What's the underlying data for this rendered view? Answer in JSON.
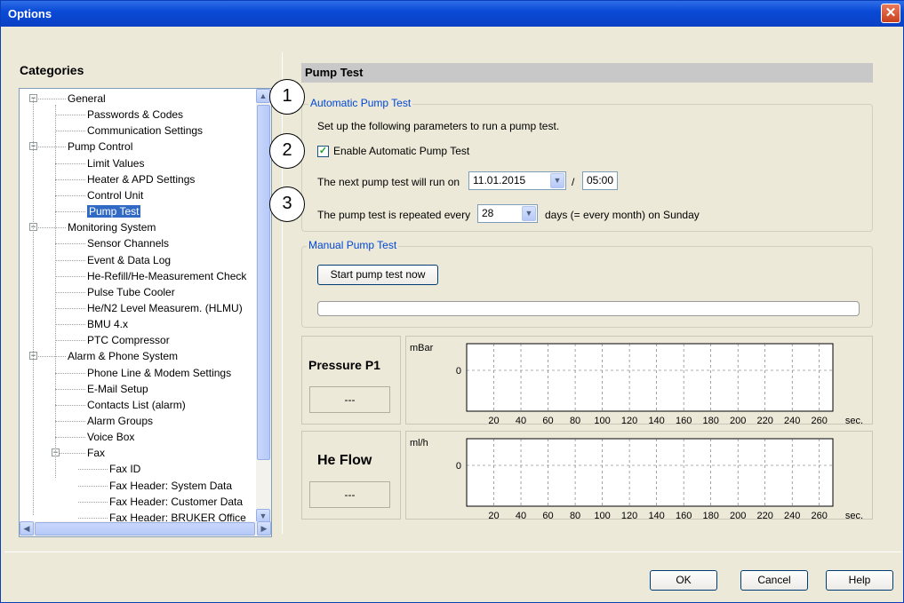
{
  "window": {
    "title": "Options",
    "close_glyph": "✕"
  },
  "categories": {
    "heading": "Categories",
    "items": [
      {
        "label": "General",
        "level": 0,
        "expanded": true
      },
      {
        "label": "Passwords & Codes",
        "level": 1
      },
      {
        "label": "Communication Settings",
        "level": 1
      },
      {
        "label": "Pump Control",
        "level": 0,
        "expanded": true
      },
      {
        "label": "Limit Values",
        "level": 1
      },
      {
        "label": "Heater & APD Settings",
        "level": 1
      },
      {
        "label": "Control Unit",
        "level": 1
      },
      {
        "label": "Pump Test",
        "level": 1,
        "selected": true
      },
      {
        "label": "Monitoring System",
        "level": 0,
        "expanded": true
      },
      {
        "label": "Sensor Channels",
        "level": 1
      },
      {
        "label": "Event & Data Log",
        "level": 1
      },
      {
        "label": "He-Refill/He-Measurement Check",
        "level": 1
      },
      {
        "label": "Pulse Tube Cooler",
        "level": 1
      },
      {
        "label": "He/N2 Level Measurem. (HLMU)",
        "level": 1
      },
      {
        "label": "BMU 4.x",
        "level": 1
      },
      {
        "label": "PTC Compressor",
        "level": 1
      },
      {
        "label": "Alarm & Phone System",
        "level": 0,
        "expanded": true
      },
      {
        "label": "Phone Line & Modem Settings",
        "level": 1
      },
      {
        "label": "E-Mail Setup",
        "level": 1
      },
      {
        "label": "Contacts List (alarm)",
        "level": 1
      },
      {
        "label": "Alarm Groups",
        "level": 1
      },
      {
        "label": "Voice Box",
        "level": 1
      },
      {
        "label": "Fax",
        "level": 1,
        "expanded": true
      },
      {
        "label": "Fax ID",
        "level": 2
      },
      {
        "label": "Fax Header: System Data",
        "level": 2
      },
      {
        "label": "Fax Header: Customer Data",
        "level": 2
      },
      {
        "label": "Fax Header: BRUKER Office",
        "level": 2
      }
    ]
  },
  "section": {
    "title": "Pump Test"
  },
  "auto": {
    "legend": "Automatic Pump Test",
    "description": "Set up the following parameters to run a pump test.",
    "enable_label": "Enable Automatic Pump Test",
    "enabled": true,
    "next_label": "The next pump test will run on",
    "next_date": "11.01.2015",
    "separator": "/",
    "next_time": "05:00",
    "repeat_label": "The pump test is repeated every",
    "repeat_value": "28",
    "repeat_suffix": "days (= every month) on Sunday"
  },
  "manual": {
    "legend": "Manual Pump Test",
    "start_button": "Start pump test now",
    "progress": 0
  },
  "callouts": [
    "1",
    "2",
    "3"
  ],
  "meters": [
    {
      "title": "Pressure P1",
      "value": "---",
      "unit": "mBar",
      "zero_label": "0"
    },
    {
      "title": "He Flow",
      "value": "---",
      "unit": "ml/h",
      "zero_label": "0"
    }
  ],
  "chart_data": [
    {
      "type": "line",
      "ylabel": "mBar",
      "xlabel": "sec.",
      "x_ticks": [
        20,
        40,
        60,
        80,
        100,
        120,
        140,
        160,
        180,
        200,
        220,
        240,
        260
      ],
      "y_ticks": [
        0
      ],
      "grid": true,
      "series": []
    },
    {
      "type": "line",
      "ylabel": "ml/h",
      "xlabel": "sec.",
      "x_ticks": [
        20,
        40,
        60,
        80,
        100,
        120,
        140,
        160,
        180,
        200,
        220,
        240,
        260
      ],
      "y_ticks": [
        0
      ],
      "grid": true,
      "series": []
    }
  ],
  "footer": {
    "ok": "OK",
    "cancel": "Cancel",
    "help": "Help",
    "scroll_up": "▲",
    "scroll_down": "▼",
    "scroll_left": "◀",
    "scroll_right": "▶",
    "combo_arrow": "▼"
  }
}
